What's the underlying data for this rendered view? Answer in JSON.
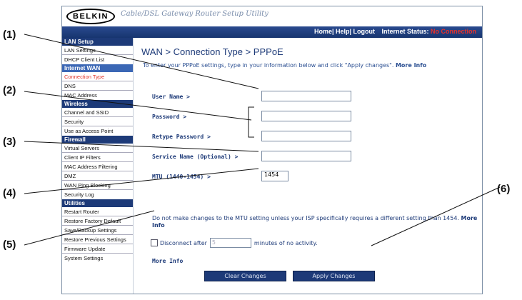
{
  "callouts": [
    "(1)",
    "(2)",
    "(3)",
    "(4)",
    "(5)",
    "(6)"
  ],
  "header": {
    "logo": "BELKIN",
    "app_title": "Cable/DSL Gateway Router Setup Utility",
    "links": "Home| Help| Logout",
    "status_label": "Internet Status:",
    "status_value": "No Connection",
    "status_color": "#e8312a"
  },
  "sidebar": {
    "sections": [
      {
        "title": "LAN Setup",
        "items": [
          "LAN Settings",
          "DHCP Client List"
        ]
      },
      {
        "title": "Internet WAN",
        "items": [
          "Connection Type",
          "DNS",
          "MAC Address"
        ]
      },
      {
        "title": "Wireless",
        "items": [
          "Channel and SSID",
          "Security",
          "Use as Access Point"
        ]
      },
      {
        "title": "Firewall",
        "items": [
          "Virtual Servers",
          "Client IP Filters",
          "MAC Address Filtering",
          "DMZ",
          "WAN Ping Blocking",
          "Security Log"
        ]
      },
      {
        "title": "Utilities",
        "items": [
          "Restart Router",
          "Restore Factory Default",
          "Save/Backup Settings",
          "Restore Previous Settings",
          "Firmware Update",
          "System Settings"
        ]
      }
    ],
    "current_item": "Connection Type"
  },
  "main": {
    "heading": "WAN > Connection Type > PPPoE",
    "intro": "To enter your PPPoE settings, type in your information below and click \"Apply changes\".",
    "intro_more": "More Info",
    "fields": {
      "username_label": "User Name >",
      "username_value": "",
      "password_label": "Password >",
      "password_value": "",
      "retype_label": "Retype Password >",
      "retype_value": "",
      "service_label": "Service Name (Optional) >",
      "service_value": "",
      "mtu_label": "MTU (1440-1454) >",
      "mtu_value": "1454"
    },
    "mtu_note": "Do not make changes to the MTU setting unless your ISP specifically requires a different setting than 1454.",
    "mtu_note_more": "More Info",
    "disconnect_label": "Disconnect after",
    "disconnect_value": "5",
    "disconnect_suffix": "minutes of no activity.",
    "more_info": "More Info",
    "clear_button": "Clear Changes",
    "apply_button": "Apply Changes"
  }
}
